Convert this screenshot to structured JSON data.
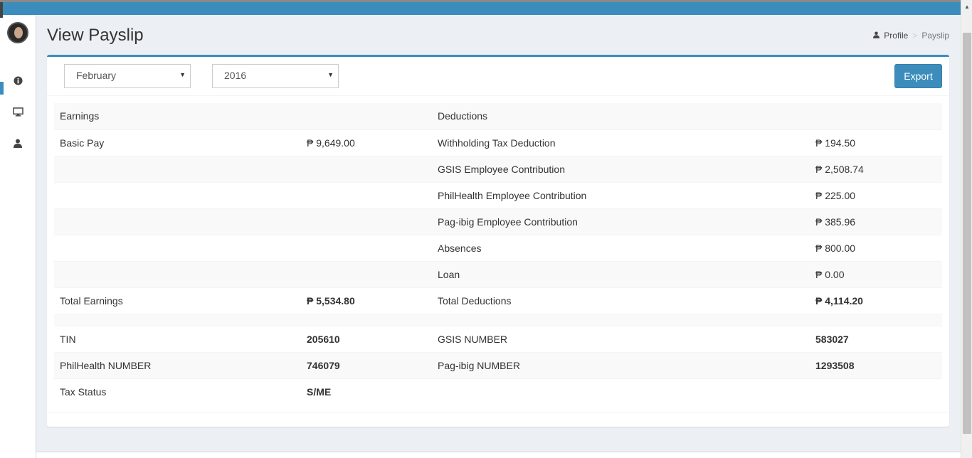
{
  "page": {
    "title": "View Payslip",
    "breadcrumb": [
      {
        "label": "Profile",
        "icon": "user-icon"
      },
      {
        "label": "Payslip"
      }
    ]
  },
  "sidebar": {
    "icons": [
      "info-icon",
      "desktop-icon",
      "user-icon"
    ]
  },
  "filters": {
    "month": "February",
    "year": "2016",
    "export_label": "Export"
  },
  "payslip": {
    "headers": [
      "Earnings",
      "",
      "Deductions",
      ""
    ],
    "rows": [
      [
        "Basic Pay",
        "₱ 9,649.00",
        "Withholding Tax Deduction",
        "₱ 194.50"
      ],
      [
        "",
        "",
        "GSIS Employee Contribution",
        "₱ 2,508.74"
      ],
      [
        "",
        "",
        "PhilHealth Employee Contribution",
        "₱ 225.00"
      ],
      [
        "",
        "",
        "Pag-ibig Employee Contribution",
        "₱ 385.96"
      ],
      [
        "",
        "",
        "Absences",
        "₱ 800.00"
      ],
      [
        "",
        "",
        "Loan",
        "₱ 0.00"
      ]
    ],
    "totals": [
      "Total Earnings",
      "₱ 5,534.80",
      "Total Deductions",
      "₱ 4,114.20"
    ],
    "ids": [
      [
        "TIN",
        "205610",
        "GSIS NUMBER",
        "583027"
      ],
      [
        "PhilHealth NUMBER",
        "746079",
        "Pag-ibig NUMBER",
        "1293508"
      ],
      [
        "Tax Status",
        "S/ME",
        "",
        ""
      ]
    ]
  },
  "colors": {
    "accent": "#3c8dbc",
    "background": "#ecf0f5"
  }
}
